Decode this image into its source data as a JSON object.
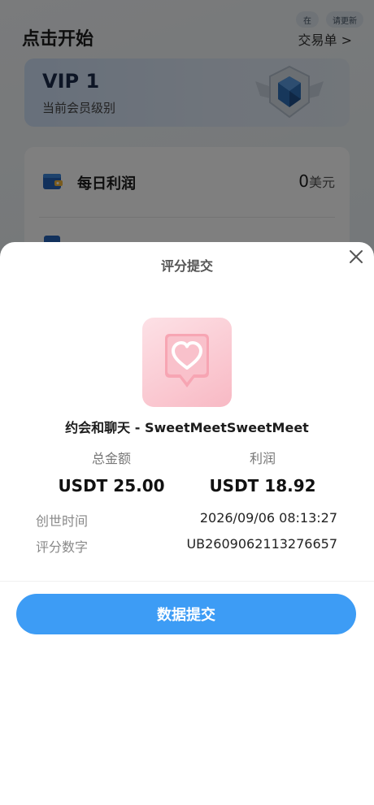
{
  "page": {
    "title": "点击开始",
    "chips": [
      "在",
      "请更新"
    ],
    "orders_link": "交易单 >"
  },
  "vip": {
    "level": "VIP 1",
    "description": "当前会员级别"
  },
  "stats": {
    "daily_profit_label": "每日利润",
    "daily_profit_value": "0",
    "daily_profit_unit": "美元"
  },
  "modal": {
    "title": "评分提交",
    "product_name": "约会和聊天 - SweetMeetSweetMeet",
    "total_label": "总金额",
    "total_value": "USDT 25.00",
    "profit_label": "利润",
    "profit_value": "USDT 18.92",
    "created_label": "创世时间",
    "created_value": "2026/09/06 08:13:27",
    "rating_no_label": "评分数字",
    "rating_no_value": "UB2609062113276657",
    "submit_label": "数据提交"
  },
  "colors": {
    "accent": "#3d9cf5",
    "overlay": "rgba(0,0,0,0.5)",
    "vip_card": "#cfe0f6",
    "product_bg": "#f8b9c4"
  },
  "icons": {
    "close": "close-icon",
    "wallet": "wallet-icon",
    "vip_badge": "vip-badge-icon",
    "heart": "heart-icon"
  }
}
